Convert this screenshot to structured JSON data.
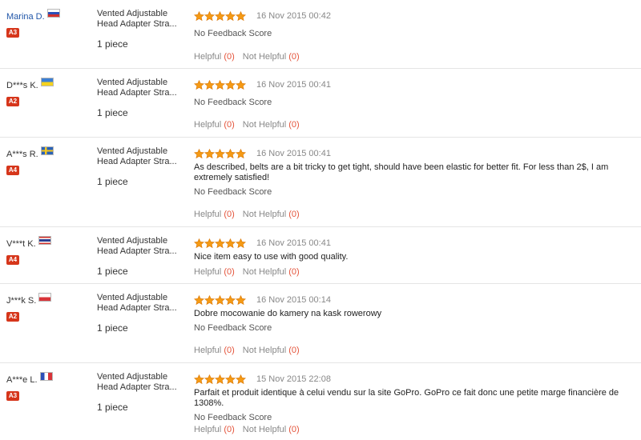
{
  "colors": {
    "star": "#f59a14",
    "level_badge": "#d6361b",
    "link": "#1f55a8",
    "vote_count": "#e4543b"
  },
  "labels": {
    "helpful": "Helpful",
    "not_helpful": "Not Helpful",
    "no_feedback_score": "No Feedback Score"
  },
  "reviews": [
    {
      "buyer": "Marina D.",
      "country_flag": "russia-flag",
      "level": "A3",
      "product": "Vented Adjustable Head Adapter Stra...",
      "quantity": "1 piece",
      "stars": 5,
      "date": "16 Nov 2015 00:42",
      "comment": "",
      "feedback_score": "No Feedback Score",
      "helpful_count": "(0)",
      "not_helpful_count": "(0)"
    },
    {
      "buyer": "D***s K.",
      "country_flag": "ukraine-flag",
      "level": "A2",
      "product": "Vented Adjustable Head Adapter Stra...",
      "quantity": "1 piece",
      "stars": 5,
      "date": "16 Nov 2015 00:41",
      "comment": "",
      "feedback_score": "No Feedback Score",
      "helpful_count": "(0)",
      "not_helpful_count": "(0)"
    },
    {
      "buyer": "A***s R.",
      "country_flag": "sweden-flag",
      "level": "A4",
      "product": "Vented Adjustable Head Adapter Stra...",
      "quantity": "1 piece",
      "stars": 5,
      "date": "16 Nov 2015 00:41",
      "comment": "As described, belts are a bit tricky to get tight, should have been elastic for better fit. For less than 2$, I am extremely satisfied!",
      "feedback_score": "No Feedback Score",
      "helpful_count": "(0)",
      "not_helpful_count": "(0)"
    },
    {
      "buyer": "V***t K.",
      "country_flag": "thailand-flag",
      "level": "A4",
      "product": "Vented Adjustable Head Adapter Stra...",
      "quantity": "1 piece",
      "stars": 5,
      "date": "16 Nov 2015 00:41",
      "comment": "Nice item easy to use with good quality.",
      "feedback_score": "",
      "helpful_count": "(0)",
      "not_helpful_count": "(0)"
    },
    {
      "buyer": "J***k S.",
      "country_flag": "poland-flag",
      "level": "A2",
      "product": "Vented Adjustable Head Adapter Stra...",
      "quantity": "1 piece",
      "stars": 5,
      "date": "16 Nov 2015 00:14",
      "comment": "Dobre mocowanie do kamery na kask rowerowy",
      "feedback_score": "No Feedback Score",
      "helpful_count": "(0)",
      "not_helpful_count": "(0)"
    },
    {
      "buyer": "A***e L.",
      "country_flag": "france-flag",
      "level": "A3",
      "product": "Vented Adjustable Head Adapter Stra...",
      "quantity": "1 piece",
      "stars": 5,
      "date": "15 Nov 2015 22:08",
      "comment": "Parfait et produit identique à celui vendu sur la site GoPro. GoPro ce fait donc une petite marge financière de 1308%.",
      "feedback_score": "No Feedback Score",
      "helpful_count": "(0)",
      "not_helpful_count": "(0)"
    }
  ]
}
